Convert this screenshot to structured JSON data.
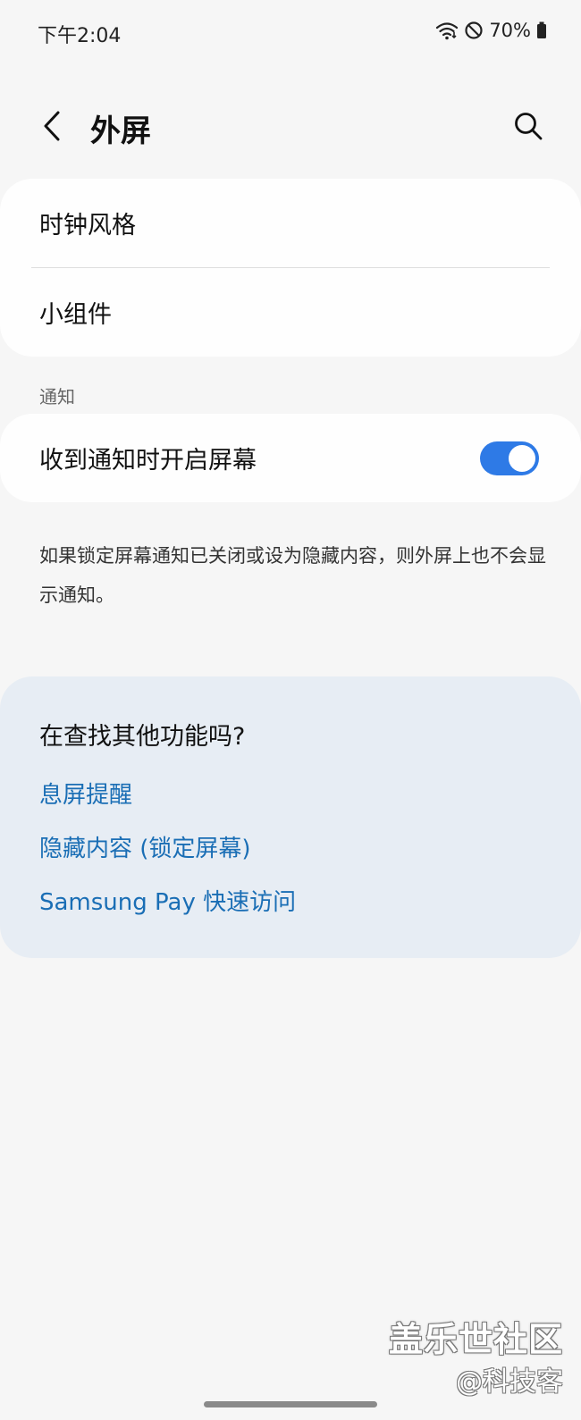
{
  "status_bar": {
    "time": "下午2:04",
    "battery": "70%",
    "icons": [
      "wifi-icon",
      "do-not-disturb-icon",
      "battery-icon"
    ]
  },
  "header": {
    "title": "外屏",
    "back_icon": "back-chevron-icon",
    "search_icon": "search-icon"
  },
  "display_card": {
    "items": [
      {
        "label": "时钟风格"
      },
      {
        "label": "小组件"
      }
    ]
  },
  "notification_section": {
    "label": "通知",
    "toggle_row": {
      "label": "收到通知时开启屏幕",
      "enabled": true
    }
  },
  "note": "如果锁定屏幕通知已关闭或设为隐藏内容，则外屏上也不会显示通知。",
  "suggestions": {
    "title": "在查找其他功能吗?",
    "links": [
      {
        "label": "息屏提醒"
      },
      {
        "label": "隐藏内容 (锁定屏幕)"
      },
      {
        "label": "Samsung Pay 快速访问"
      }
    ]
  },
  "watermark": {
    "main": "盖乐世社区",
    "sub": "@科技客"
  },
  "colors": {
    "accent": "#2e7ae6",
    "link": "#1a6eb5",
    "background": "#f6f6f6",
    "suggestion_card": "#e7edf4"
  }
}
